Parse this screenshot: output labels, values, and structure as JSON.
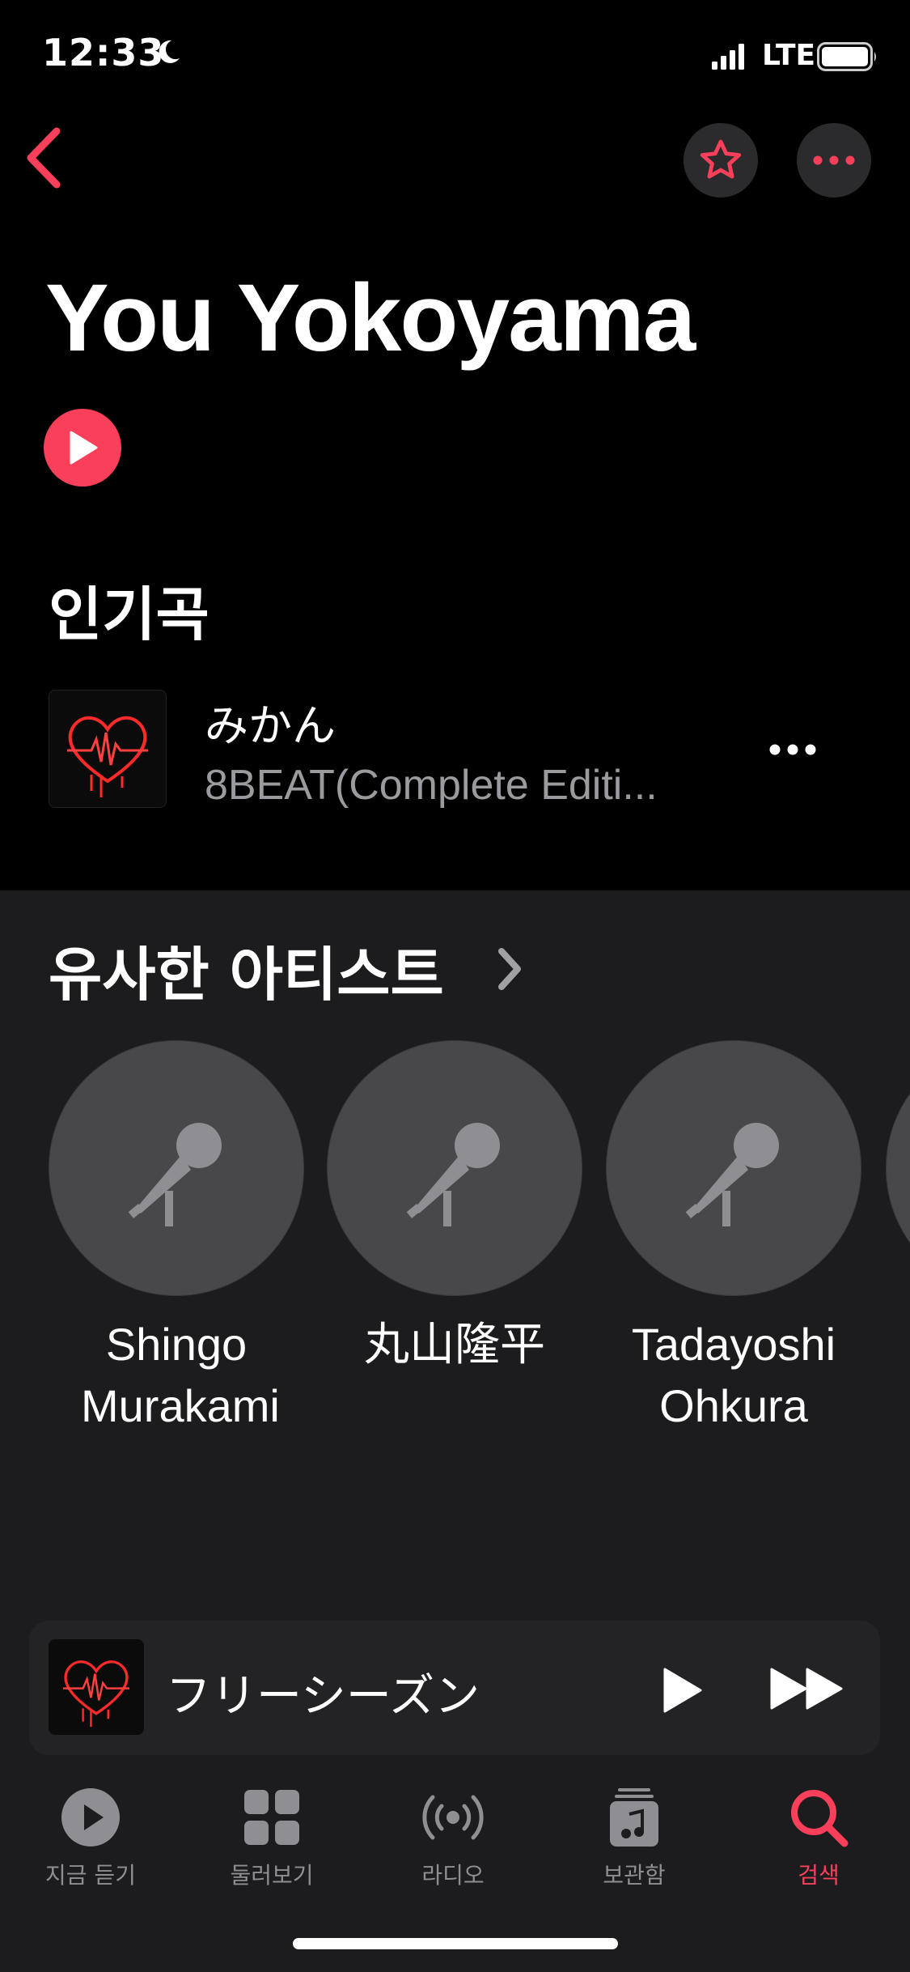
{
  "status_bar": {
    "time": "12:33",
    "network": "LTE"
  },
  "artist": {
    "name": "You Yokoyama"
  },
  "popular": {
    "title": "인기곡",
    "songs": [
      {
        "title": "みかん",
        "album": "8BEAT(Complete Editi..."
      }
    ]
  },
  "similar": {
    "title": "유사한 아티스트",
    "artists": [
      "Shingo Murakami",
      "丸山隆平",
      "Tadayoshi Ohkura"
    ]
  },
  "mini_player": {
    "title": "フリーシーズン"
  },
  "tabs": [
    {
      "label": "지금 듣기",
      "icon": "play-circle-icon"
    },
    {
      "label": "둘러보기",
      "icon": "grid-icon"
    },
    {
      "label": "라디오",
      "icon": "radio-icon"
    },
    {
      "label": "보관함",
      "icon": "library-icon"
    },
    {
      "label": "검색",
      "icon": "search-icon",
      "active": true
    }
  ],
  "colors": {
    "accent": "#fa3f5b",
    "background": "#000000",
    "section": "#1c1c1e"
  }
}
